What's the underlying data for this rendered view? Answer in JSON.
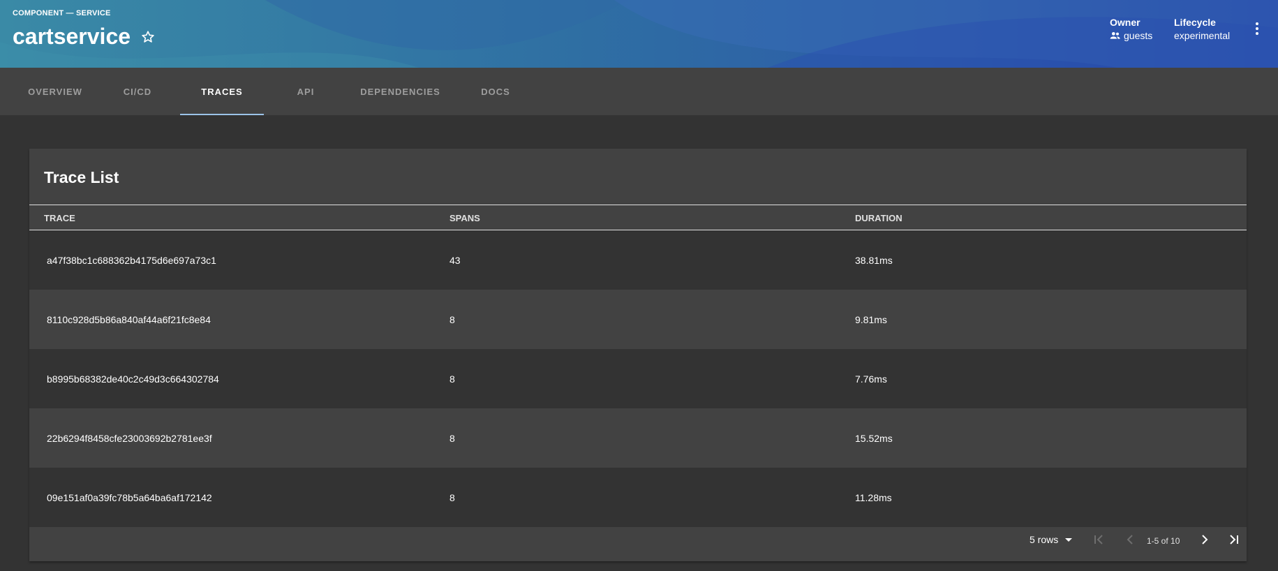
{
  "header": {
    "kind_label": "COMPONENT — SERVICE",
    "title": "cartservice",
    "owner_label": "Owner",
    "owner_value": "guests",
    "lifecycle_label": "Lifecycle",
    "lifecycle_value": "experimental"
  },
  "tabs": [
    {
      "label": "OVERVIEW"
    },
    {
      "label": "CI/CD"
    },
    {
      "label": "TRACES",
      "active": true
    },
    {
      "label": "API"
    },
    {
      "label": "DEPENDENCIES"
    },
    {
      "label": "DOCS"
    }
  ],
  "trace_list": {
    "title": "Trace List",
    "columns": [
      "TRACE",
      "SPANS",
      "DURATION"
    ],
    "rows": [
      {
        "trace": "a47f38bc1c688362b4175d6e697a73c1",
        "spans": "43",
        "duration": "38.81ms"
      },
      {
        "trace": "8110c928d5b86a840af44a6f21fc8e84",
        "spans": "8",
        "duration": "9.81ms"
      },
      {
        "trace": "b8995b68382de40c2c49d3c664302784",
        "spans": "8",
        "duration": "7.76ms"
      },
      {
        "trace": "22b6294f8458cfe23003692b2781ee3f",
        "spans": "8",
        "duration": "15.52ms"
      },
      {
        "trace": "09e151af0a39fc78b5a64ba6af172142",
        "spans": "8",
        "duration": "11.28ms"
      }
    ],
    "pagination": {
      "rows_per_page": "5 rows",
      "range": "1-5 of 10"
    }
  },
  "icons": {
    "star": "star-outline-icon",
    "owner": "group-icon",
    "menu": "more-vert-icon",
    "first": "first-page-icon",
    "prev": "chevron-left-icon",
    "next": "chevron-right-icon",
    "last": "last-page-icon"
  },
  "colors": {
    "header_start": "#3a8aa6",
    "header_end": "#2341a8",
    "tab_indicator": "#9cc3e8",
    "background": "#333333",
    "card": "#424242"
  }
}
